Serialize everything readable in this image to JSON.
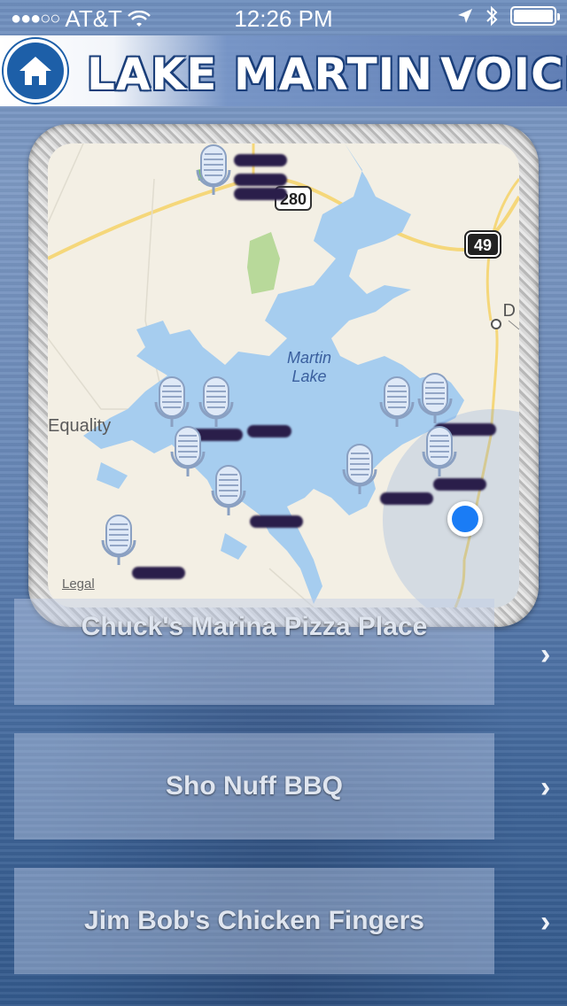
{
  "status_bar": {
    "signal_dots": "●●●○○",
    "carrier": "AT&T",
    "time": "12:26 PM"
  },
  "header": {
    "title_left": "LAKE MARTIN",
    "title_right": "VOICE",
    "home_icon": "home-icon",
    "logo_icon": "microphone-icon"
  },
  "map": {
    "lake_label_1": "Martin",
    "lake_label_2": "Lake",
    "town_label": "Equality",
    "edge_label": "D",
    "route_280": "280",
    "route_49": "49",
    "legal": "Legal",
    "pin_icon": "microphone-pin-icon",
    "colors": {
      "water": "#a6cdef",
      "land": "#f3efe4",
      "park": "#b8d99a",
      "road": "#f5d77a",
      "user_dot": "#1a7cf5"
    }
  },
  "list": {
    "items": [
      {
        "label": "Chuck's Marina Pizza Place"
      },
      {
        "label": "Sho Nuff BBQ"
      },
      {
        "label": "Jim Bob's Chicken Fingers"
      }
    ],
    "chevron": "›"
  }
}
